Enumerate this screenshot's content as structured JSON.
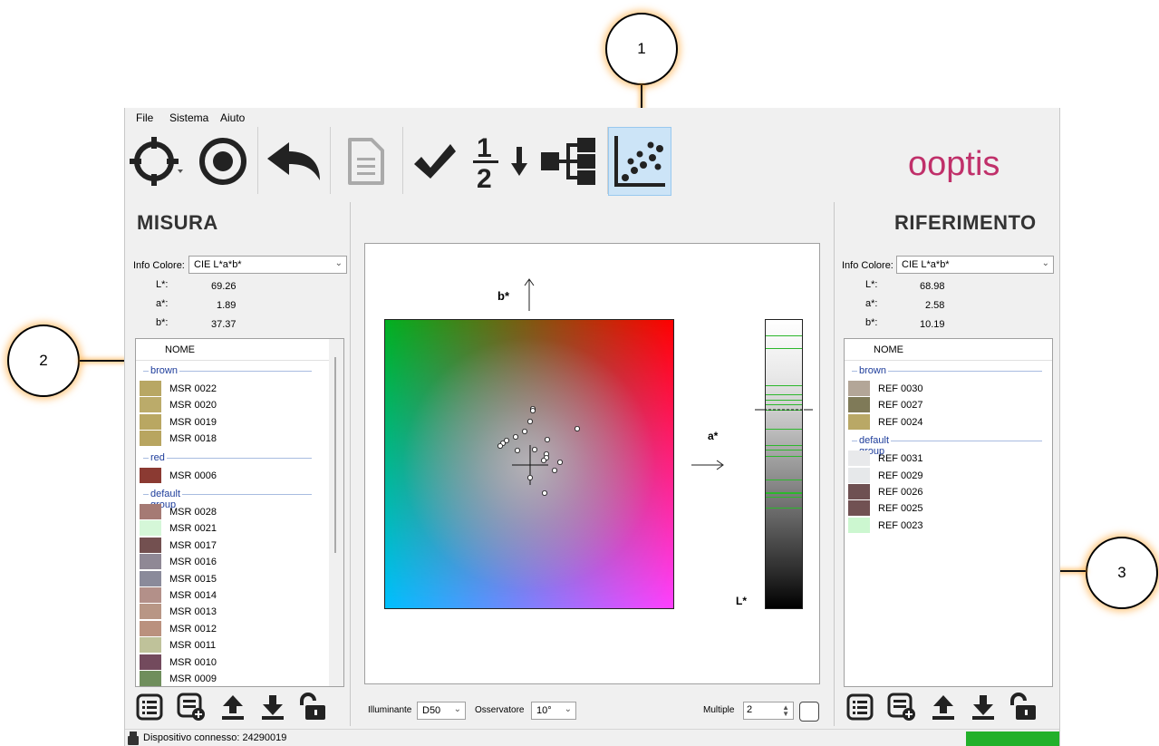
{
  "menu": [
    "File",
    "Sistema",
    "Aiuto"
  ],
  "toolbar": {
    "tools": [
      "crosshair-target-icon",
      "record-icon",
      "undo-icon",
      "document-icon",
      "checkmark-icon",
      "one-half-icon",
      "arrow-down-icon",
      "tree-hierarchy-icon",
      "scatter-plot-icon"
    ],
    "active": "scatter-plot-icon"
  },
  "brand": "ooptis",
  "left_panel": {
    "title": "MISURA",
    "info_label": "Info Colore:",
    "info_value": "CIE L*a*b*",
    "values": [
      {
        "label": "L*:",
        "value": "69.26"
      },
      {
        "label": "a*:",
        "value": "1.89"
      },
      {
        "label": "b*:",
        "value": "37.37"
      }
    ],
    "list_header": "NOME",
    "groups": [
      {
        "name": "brown",
        "items": [
          {
            "name": "MSR 0022",
            "color": "#b8a764"
          },
          {
            "name": "MSR 0020",
            "color": "#bbab6a"
          },
          {
            "name": "MSR 0019",
            "color": "#b9a762"
          },
          {
            "name": "MSR 0018",
            "color": "#b8a560"
          }
        ]
      },
      {
        "name": "red",
        "items": [
          {
            "name": "MSR 0006",
            "color": "#8b3a32"
          }
        ]
      },
      {
        "name": "default group",
        "items": [
          {
            "name": "MSR 0028",
            "color": "#a57a74"
          },
          {
            "name": "MSR 0021",
            "color": "#d5f7d8"
          },
          {
            "name": "MSR 0017",
            "color": "#735050"
          },
          {
            "name": "MSR 0016",
            "color": "#8f8895"
          },
          {
            "name": "MSR 0015",
            "color": "#8a8a9a"
          },
          {
            "name": "MSR 0014",
            "color": "#b39089"
          },
          {
            "name": "MSR 0013",
            "color": "#b89685"
          },
          {
            "name": "MSR 0012",
            "color": "#ba917e"
          },
          {
            "name": "MSR 0011",
            "color": "#bfc29a"
          },
          {
            "name": "MSR 0010",
            "color": "#734a5d"
          },
          {
            "name": "MSR 0009",
            "color": "#6f8e5c"
          }
        ]
      }
    ]
  },
  "right_panel": {
    "title": "RIFERIMENTO",
    "info_label": "Info Colore:",
    "info_value": "CIE L*a*b*",
    "values": [
      {
        "label": "L*:",
        "value": "68.98"
      },
      {
        "label": "a*:",
        "value": "2.58"
      },
      {
        "label": "b*:",
        "value": "10.19"
      }
    ],
    "list_header": "NOME",
    "groups": [
      {
        "name": "brown",
        "items": [
          {
            "name": "REF 0030",
            "color": "#b3a698"
          },
          {
            "name": "REF 0027",
            "color": "#7f7a58"
          },
          {
            "name": "REF 0024",
            "color": "#b9a866"
          }
        ]
      },
      {
        "name": "default group",
        "items": [
          {
            "name": "REF 0031",
            "color": "#e8e9eb"
          },
          {
            "name": "REF 0029",
            "color": "#e6e8ea"
          },
          {
            "name": "REF 0026",
            "color": "#6e5052"
          },
          {
            "name": "REF 0025",
            "color": "#715153"
          },
          {
            "name": "REF 0023",
            "color": "#ccf7d0"
          }
        ]
      }
    ]
  },
  "plot": {
    "b_label": "b*",
    "a_label": "a*",
    "l_label": "L*"
  },
  "bottom_controls": {
    "illuminant_label": "Illuminante",
    "illuminant_value": "D50",
    "observer_label": "Osservatore",
    "observer_value": "10°",
    "multiple_label": "Multiple",
    "multiple_value": "2"
  },
  "status": {
    "text": "Dispositivo connesso: 24290019",
    "indicator_color": "#22b02a"
  },
  "callouts": [
    "1",
    "2",
    "3"
  ]
}
